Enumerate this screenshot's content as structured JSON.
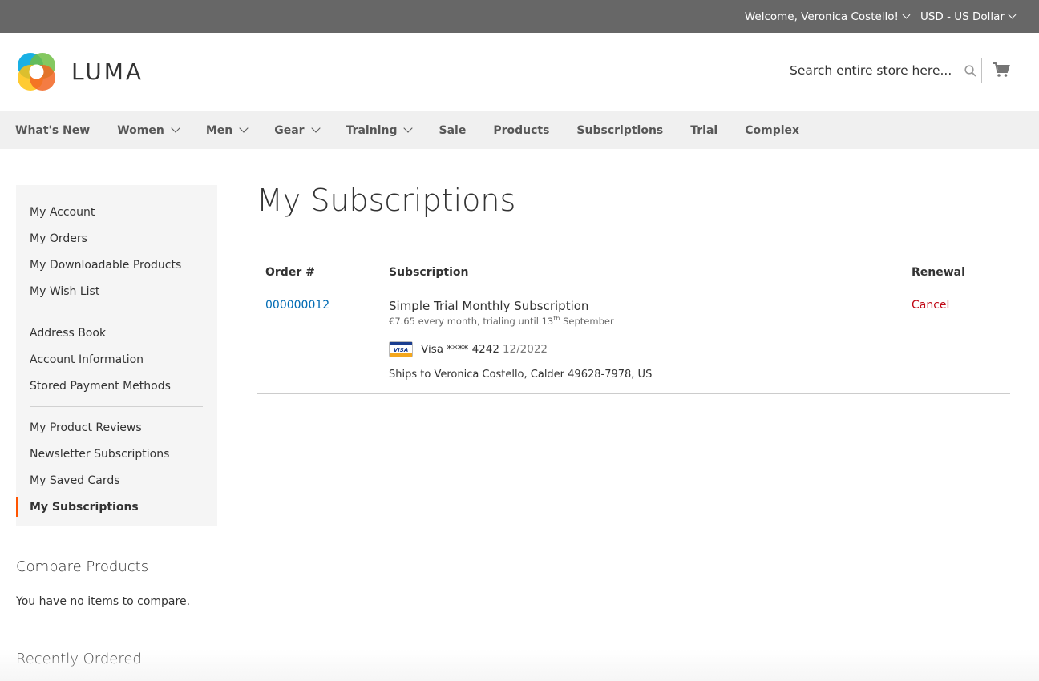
{
  "topbar": {
    "welcome": "Welcome, Veronica Costello!",
    "currency": "USD - US Dollar"
  },
  "header": {
    "logo_text": "LUMA",
    "search_placeholder": "Search entire store here..."
  },
  "nav": {
    "items": [
      {
        "label": "What's New",
        "dropdown": false
      },
      {
        "label": "Women",
        "dropdown": true
      },
      {
        "label": "Men",
        "dropdown": true
      },
      {
        "label": "Gear",
        "dropdown": true
      },
      {
        "label": "Training",
        "dropdown": true
      },
      {
        "label": "Sale",
        "dropdown": false
      },
      {
        "label": "Products",
        "dropdown": false
      },
      {
        "label": "Subscriptions",
        "dropdown": false
      },
      {
        "label": "Trial",
        "dropdown": false
      },
      {
        "label": "Complex",
        "dropdown": false
      }
    ]
  },
  "sidebar": {
    "groups": [
      [
        "My Account",
        "My Orders",
        "My Downloadable Products",
        "My Wish List"
      ],
      [
        "Address Book",
        "Account Information",
        "Stored Payment Methods"
      ],
      [
        "My Product Reviews",
        "Newsletter Subscriptions",
        "My Saved Cards",
        "My Subscriptions"
      ]
    ],
    "active": "My Subscriptions"
  },
  "main": {
    "title": "My Subscriptions",
    "columns": {
      "order": "Order #",
      "subscription": "Subscription",
      "renewal": "Renewal"
    },
    "rows": [
      {
        "order": "000000012",
        "product": "Simple Trial Monthly Subscription",
        "price_text": "€7.65 every month, trialing until 13",
        "ordinal": "th",
        "month": "September",
        "card_brand": "VISA",
        "card_text": "Visa **** 4242",
        "card_exp": "12/2022",
        "shipping": "Ships to Veronica Costello, Calder 49628-7978, US",
        "action": "Cancel"
      }
    ]
  },
  "compare": {
    "title": "Compare Products",
    "empty": "You have no items to compare."
  },
  "recent": {
    "title": "Recently Ordered"
  },
  "colors": {
    "topbar": "#676767",
    "link": "#006bb4",
    "cancel": "#c00815",
    "active_marker": "#ff5501"
  }
}
